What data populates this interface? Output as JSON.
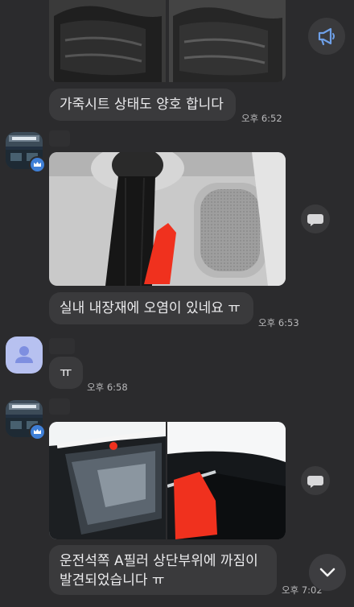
{
  "messages": {
    "m1": {
      "text": "가죽시트 상태도 양호 합니다",
      "time": "오후 6:52"
    },
    "m2": {
      "text": "실내 내장재에 오염이 있네요 ㅠ",
      "time": "오후 6:53"
    },
    "m3": {
      "text": "ㅠ",
      "time": "오후 6:58"
    },
    "m4": {
      "line1": "운전석쪽 A필러 상단부위에 까짐이",
      "line2": "발견되었습니다 ㅠ",
      "time": "오후 7:02"
    }
  },
  "icons": {
    "announcement": "megaphone-icon",
    "comment": "speech-bubble-icon",
    "scroll_down": "chevron-down-icon",
    "profile": "person-icon",
    "badge": "crown-icon"
  },
  "colors": {
    "background": "#2b2b2d",
    "bubble": "#3a3a3c",
    "accent": "#3f7fd6",
    "marker": "#f0311e"
  }
}
